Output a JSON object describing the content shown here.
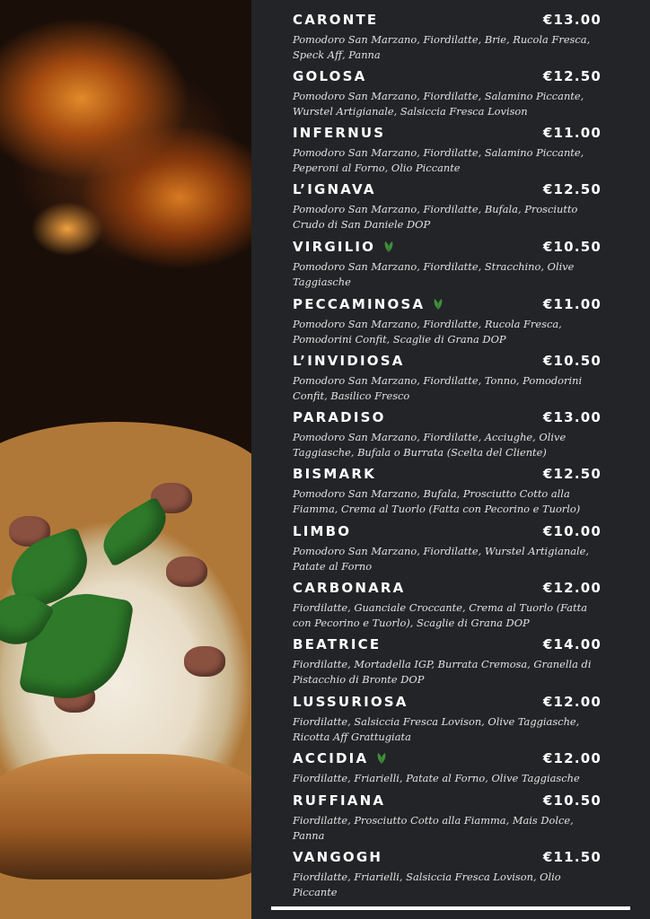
{
  "colors": {
    "background": "#232427",
    "text": "#ffffff",
    "description": "#e2e2e2",
    "veg_icon": "#3f8f3a"
  },
  "menu": [
    {
      "name": "CARONTE",
      "price": "€13.00",
      "veg": false,
      "desc": "Pomodoro San Marzano, Fiordilatte, Brie, Rucola Fresca, Speck Aff, Panna"
    },
    {
      "name": "GOLOSA",
      "price": "€12.50",
      "veg": false,
      "desc": "Pomodoro San Marzano, Fiordilatte, Salamino Piccante, Wurstel Artigianale, Salsiccia Fresca Lovison"
    },
    {
      "name": "INFERNUS",
      "price": "€11.00",
      "veg": false,
      "desc": "Pomodoro San Marzano, Fiordilatte, Salamino Piccante, Peperoni al Forno, Olio Piccante"
    },
    {
      "name": "L’IGNAVA",
      "price": "€12.50",
      "veg": false,
      "desc": "Pomodoro San Marzano, Fiordilatte, Bufala, Prosciutto Crudo di San Daniele DOP"
    },
    {
      "name": "VIRGILIO",
      "price": "€10.50",
      "veg": true,
      "desc": "Pomodoro San Marzano, Fiordilatte, Stracchino, Olive Taggiasche"
    },
    {
      "name": "PECCAMINOSA",
      "price": "€11.00",
      "veg": true,
      "desc": "Pomodoro San Marzano, Fiordilatte, Rucola Fresca, Pomodorini Confit, Scaglie di Grana DOP"
    },
    {
      "name": "L’INVIDIOSA",
      "price": "€10.50",
      "veg": false,
      "desc": "Pomodoro San Marzano, Fiordilatte, Tonno, Pomodorini Confit, Basilico Fresco"
    },
    {
      "name": "PARADISO",
      "price": "€13.00",
      "veg": false,
      "desc": "Pomodoro San Marzano, Fiordilatte, Acciughe, Olive Taggiasche, Bufala o Burrata (Scelta del Cliente)"
    },
    {
      "name": "BISMARK",
      "price": "€12.50",
      "veg": false,
      "desc": "Pomodoro San Marzano, Bufala, Prosciutto Cotto alla Fiamma, Crema al Tuorlo (Fatta con Pecorino e Tuorlo)"
    },
    {
      "name": "LIMBO",
      "price": "€10.00",
      "veg": false,
      "desc": "Pomodoro San Marzano, Fiordilatte, Wurstel Artigianale, Patate al Forno"
    },
    {
      "name": "CARBONARA",
      "price": "€12.00",
      "veg": false,
      "desc": "Fiordilatte, Guanciale Croccante, Crema al Tuorlo (Fatta con Pecorino e Tuorlo), Scaglie di Grana DOP"
    },
    {
      "name": "BEATRICE",
      "price": "€14.00",
      "veg": false,
      "desc": "Fiordilatte, Mortadella IGP, Burrata Cremosa, Granella di Pistacchio di Bronte DOP"
    },
    {
      "name": "LUSSURIOSA",
      "price": "€12.00",
      "veg": false,
      "desc": "Fiordilatte, Salsiccia Fresca Lovison, Olive Taggiasche, Ricotta Aff Grattugiata"
    },
    {
      "name": "ACCIDIA",
      "price": "€12.00",
      "veg": true,
      "desc": "Fiordilatte, Friarielli, Patate al Forno, Olive Taggiasche"
    },
    {
      "name": "RUFFIANA",
      "price": "€10.50",
      "veg": false,
      "desc": "Fiordilatte, Prosciutto Cotto alla Fiamma, Mais Dolce, Panna"
    },
    {
      "name": "VANGOGH",
      "price": "€11.50",
      "veg": false,
      "desc": "Fiordilatte, Friarielli, Salsiccia Fresca Lovison, Olio Piccante"
    }
  ]
}
